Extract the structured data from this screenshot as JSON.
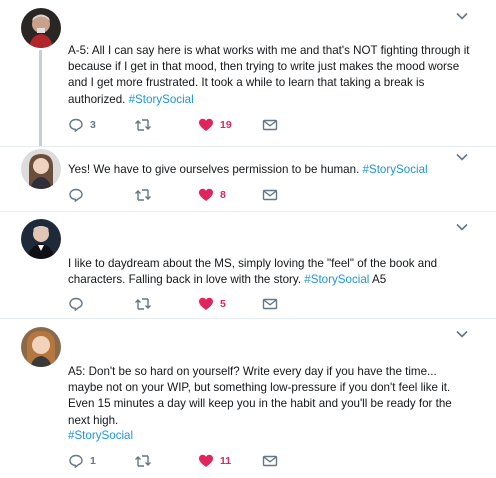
{
  "tweets": [
    {
      "text_parts": [
        "A-5: All I can say here is what works with me and that's NOT fighting through it because if I get in that mood, then trying to write just makes the mood worse and I get more frustrated. It took a while to learn that taking a break is authorized. "
      ],
      "hashtag": "#StorySocial",
      "replies": "3",
      "retweets": "",
      "likes": "19"
    },
    {
      "text_parts": [
        "Yes! We have to give ourselves permission to be human. "
      ],
      "hashtag": "#StorySocial",
      "replies": "",
      "retweets": "",
      "likes": "8"
    },
    {
      "text_parts": [
        "I like to daydream about the MS, simply loving the \"feel\" of the book and characters. Falling back in love with the story. "
      ],
      "hashtag": "#StorySocial",
      "after": " A5",
      "replies": "",
      "retweets": "",
      "likes": "5"
    },
    {
      "text_parts": [
        "A5: Don't be so hard on yourself?  Write every day if you have the time... maybe not on your WIP, but something low-pressure if you don't feel like it.  Even 15 minutes a day will keep you in the habit and you'll be ready for the next high."
      ],
      "hashtag": "#StorySocial",
      "replies": "1",
      "retweets": "",
      "likes": "11"
    }
  ],
  "colors": {
    "like": "#e0245e",
    "hashtag": "#1b95e0",
    "icon": "#657786",
    "divider": "#e6ecf0"
  }
}
